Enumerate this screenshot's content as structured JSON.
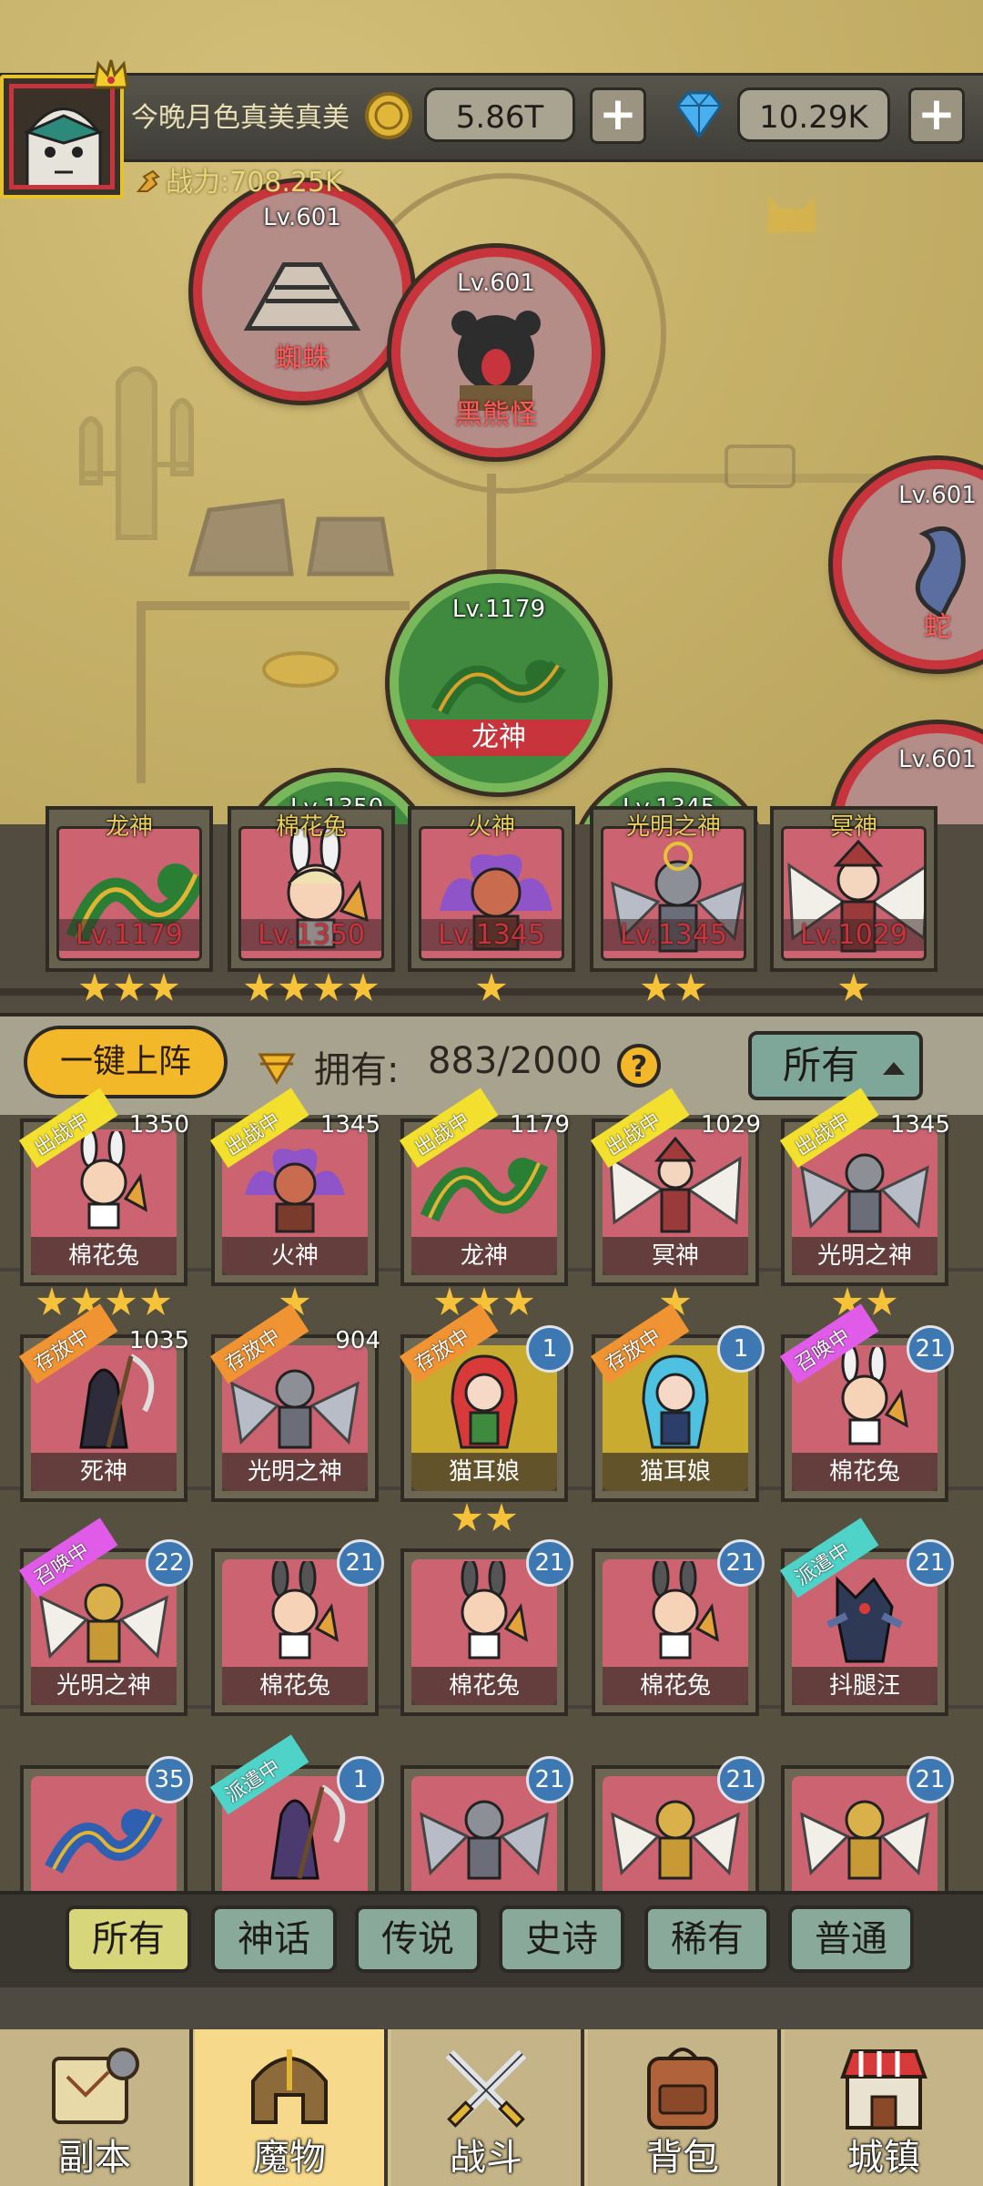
{
  "player": {
    "name": "今晚月色真美真美",
    "gold": "5.86T",
    "gems": "10.29K",
    "power_label": "战力:708.25K"
  },
  "map_nodes": [
    {
      "level": "Lv.601",
      "name": "蜘蛛"
    },
    {
      "level": "Lv.601",
      "name": "黑熊怪"
    },
    {
      "level": "Lv.601",
      "name": "蛇"
    },
    {
      "level": "Lv.1179",
      "name": "龙神"
    },
    {
      "level": "Lv.601",
      "name": ""
    },
    {
      "level": "Lv.1350",
      "name": ""
    },
    {
      "level": "Lv.1345",
      "name": ""
    }
  ],
  "lineup": [
    {
      "name": "龙神",
      "level": "Lv.1179",
      "stars": 3
    },
    {
      "name": "棉花兔",
      "level": "Lv.1350",
      "stars": 4
    },
    {
      "name": "火神",
      "level": "Lv.1345",
      "stars": 1
    },
    {
      "name": "光明之神",
      "level": "Lv.1345",
      "stars": 2
    },
    {
      "name": "冥神",
      "level": "Lv.1029",
      "stars": 1
    }
  ],
  "controls": {
    "deploy_label": "一键上阵",
    "own_label": "拥有:",
    "own_value": "883/2000",
    "help": "?",
    "filter_label": "所有"
  },
  "status_tags": {
    "battle": "出战中",
    "store": "存放中",
    "summon": "召唤中",
    "dispatch": "派遣中"
  },
  "grid": [
    {
      "name": "棉花兔",
      "tag": "出战中",
      "top_num": "1350",
      "stars": 4
    },
    {
      "name": "火神",
      "tag": "出战中",
      "top_num": "1345",
      "stars": 1
    },
    {
      "name": "龙神",
      "tag": "出战中",
      "top_num": "1179",
      "stars": 3
    },
    {
      "name": "冥神",
      "tag": "出战中",
      "top_num": "1029",
      "stars": 1
    },
    {
      "name": "光明之神",
      "tag": "出战中",
      "top_num": "1345",
      "stars": 2
    },
    {
      "name": "死神",
      "tag": "存放中",
      "top_num": "1035",
      "stars": 0
    },
    {
      "name": "光明之神",
      "tag": "存放中",
      "top_num": "904",
      "stars": 0
    },
    {
      "name": "猫耳娘",
      "tag": "存放中",
      "badge": "1",
      "stars": 2
    },
    {
      "name": "猫耳娘",
      "tag": "存放中",
      "badge": "1",
      "stars": 0
    },
    {
      "name": "棉花兔",
      "tag": "召唤中",
      "badge": "21",
      "stars": 0
    },
    {
      "name": "光明之神",
      "tag": "召唤中",
      "badge": "22",
      "stars": 0
    },
    {
      "name": "棉花兔",
      "tag": "",
      "badge": "21",
      "stars": 0
    },
    {
      "name": "棉花兔",
      "tag": "",
      "badge": "21",
      "stars": 0
    },
    {
      "name": "棉花兔",
      "tag": "",
      "badge": "21",
      "stars": 0
    },
    {
      "name": "抖腿汪",
      "tag": "派遣中",
      "badge": "21",
      "stars": 0
    },
    {
      "name": "",
      "tag": "",
      "badge": "35",
      "stars": 0
    },
    {
      "name": "",
      "tag": "派遣中",
      "badge": "1",
      "stars": 0
    },
    {
      "name": "",
      "tag": "",
      "badge": "21",
      "stars": 0
    },
    {
      "name": "",
      "tag": "",
      "badge": "21",
      "stars": 0
    },
    {
      "name": "",
      "tag": "",
      "badge": "21",
      "stars": 0
    }
  ],
  "rarity_filters": [
    "所有",
    "神话",
    "传说",
    "史诗",
    "稀有",
    "普通"
  ],
  "nav": [
    "副本",
    "魔物",
    "战斗",
    "背包",
    "城镇"
  ]
}
